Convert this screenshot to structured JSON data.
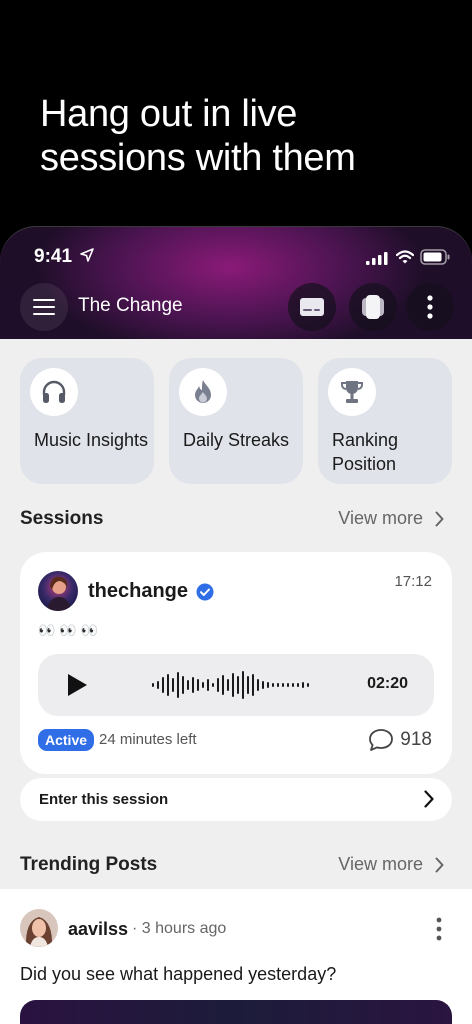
{
  "headline": "Hang out in live sessions with them",
  "status_bar": {
    "time": "9:41"
  },
  "app_bar": {
    "title": "The Change"
  },
  "tiles": [
    {
      "label": "Music Insights",
      "icon": "headphones-icon"
    },
    {
      "label": "Daily Streaks",
      "icon": "flame-icon"
    },
    {
      "label": "Ranking Position",
      "icon": "trophy-icon"
    }
  ],
  "sessions": {
    "title": "Sessions",
    "view_more": "View more",
    "card": {
      "user": "thechange",
      "verified": true,
      "time": "17:12",
      "emoji": "👀 👀 👀",
      "duration": "02:20",
      "status": "Active",
      "time_left": "24 minutes left",
      "comments": "918"
    },
    "enter_label": "Enter this session"
  },
  "trending": {
    "title": "Trending Posts",
    "view_more": "View more",
    "post": {
      "user": "aavilss",
      "ago": "· 3 hours ago",
      "text": "Did you see what happened yesterday?"
    }
  },
  "colors": {
    "accent": "#2f6ee6",
    "background": "#efefef",
    "tile": "#e1e3ea"
  }
}
